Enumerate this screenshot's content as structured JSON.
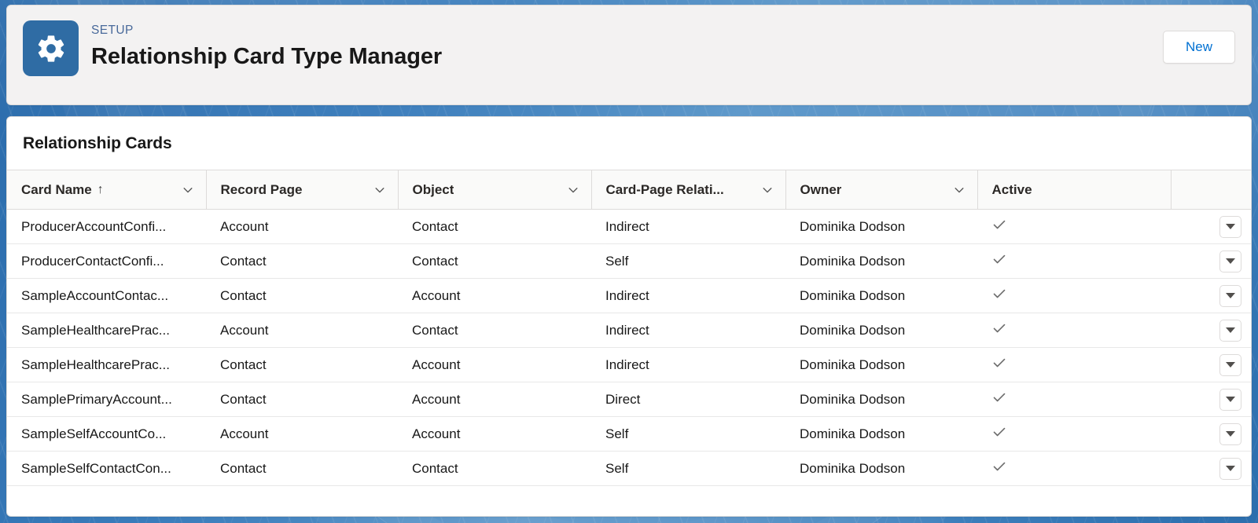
{
  "header": {
    "eyebrow": "SETUP",
    "title": "Relationship Card Type Manager",
    "icon": "gear-icon",
    "icon_background": "#2f6ca4",
    "new_button_label": "New",
    "new_button_color": "#0070d2"
  },
  "list": {
    "title": "Relationship Cards",
    "columns": [
      {
        "label": "Card Name",
        "sorted": true,
        "sort_direction": "ascending",
        "sort_glyph": "↑",
        "has_menu": true
      },
      {
        "label": "Record Page",
        "sorted": false,
        "sort_direction": "",
        "sort_glyph": "",
        "has_menu": true
      },
      {
        "label": "Object",
        "sorted": false,
        "sort_direction": "",
        "sort_glyph": "",
        "has_menu": true
      },
      {
        "label": "Card-Page Relati...",
        "sorted": false,
        "sort_direction": "",
        "sort_glyph": "",
        "has_menu": true
      },
      {
        "label": "Owner",
        "sorted": false,
        "sort_direction": "",
        "sort_glyph": "",
        "has_menu": true
      },
      {
        "label": "Active",
        "sorted": false,
        "sort_direction": "",
        "sort_glyph": "",
        "has_menu": false
      }
    ],
    "rows": [
      {
        "card_name": "ProducerAccountConfi...",
        "record_page": "Account",
        "object": "Contact",
        "card_page_relationship": "Indirect",
        "owner": "Dominika Dodson",
        "active": true
      },
      {
        "card_name": "ProducerContactConfi...",
        "record_page": "Contact",
        "object": "Contact",
        "card_page_relationship": "Self",
        "owner": "Dominika Dodson",
        "active": true
      },
      {
        "card_name": "SampleAccountContac...",
        "record_page": "Contact",
        "object": "Account",
        "card_page_relationship": "Indirect",
        "owner": "Dominika Dodson",
        "active": true
      },
      {
        "card_name": "SampleHealthcarePrac...",
        "record_page": "Account",
        "object": "Contact",
        "card_page_relationship": "Indirect",
        "owner": "Dominika Dodson",
        "active": true
      },
      {
        "card_name": "SampleHealthcarePrac...",
        "record_page": "Contact",
        "object": "Account",
        "card_page_relationship": "Indirect",
        "owner": "Dominika Dodson",
        "active": true
      },
      {
        "card_name": "SamplePrimaryAccount...",
        "record_page": "Contact",
        "object": "Account",
        "card_page_relationship": "Direct",
        "owner": "Dominika Dodson",
        "active": true
      },
      {
        "card_name": "SampleSelfAccountCo...",
        "record_page": "Account",
        "object": "Account",
        "card_page_relationship": "Self",
        "owner": "Dominika Dodson",
        "active": true
      },
      {
        "card_name": "SampleSelfContactCon...",
        "record_page": "Contact",
        "object": "Contact",
        "card_page_relationship": "Self",
        "owner": "Dominika Dodson",
        "active": true
      }
    ]
  }
}
